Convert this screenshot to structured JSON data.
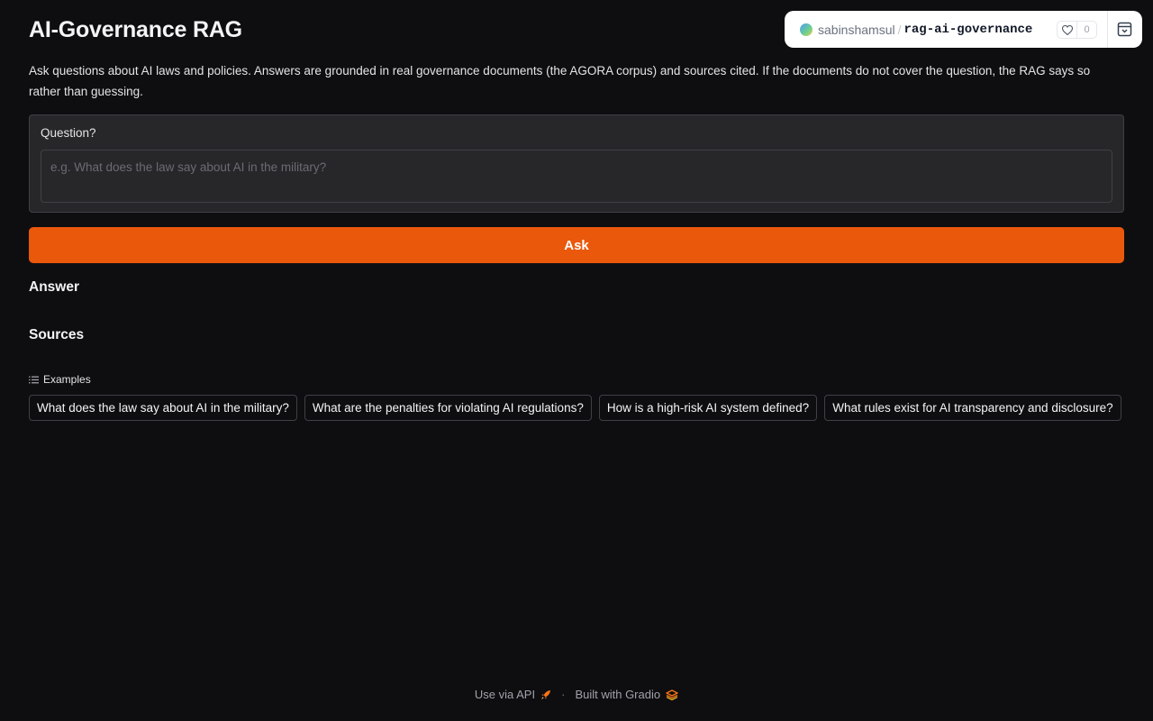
{
  "app": {
    "title": "AI-Governance RAG",
    "description": "Ask questions about AI laws and policies. Answers are grounded in real governance documents (the AGORA corpus) and sources cited. If the documents do not cover the question, the RAG says so rather than guessing."
  },
  "hf_badge": {
    "user": "sabinshamsul",
    "separator": "/",
    "repo": "rag-ai-governance",
    "likes": "0",
    "heart_icon": "heart-icon",
    "collapse_icon": "collapse-icon"
  },
  "question": {
    "label": "Question?",
    "value": "",
    "placeholder": "e.g. What does the law say about AI in the military?"
  },
  "ask_button": {
    "label": "Ask"
  },
  "answer": {
    "heading": "Answer"
  },
  "sources": {
    "heading": "Sources"
  },
  "examples": {
    "label": "Examples",
    "icon": "list-icon",
    "items": [
      "What does the law say about AI in the military?",
      "What are the penalties for violating AI regulations?",
      "How is a high-risk AI system defined?",
      "What rules exist for AI transparency and disclosure?"
    ]
  },
  "footer": {
    "api_link": "Use via API",
    "separator": "·",
    "built_with": "Built with Gradio",
    "rocket_icon": "rocket-icon",
    "gradio_icon": "gradio-logo-icon"
  },
  "colors": {
    "background": "#0e0e11",
    "accent": "#ea580c",
    "panel": "#27272a",
    "border": "#3f3f46"
  }
}
